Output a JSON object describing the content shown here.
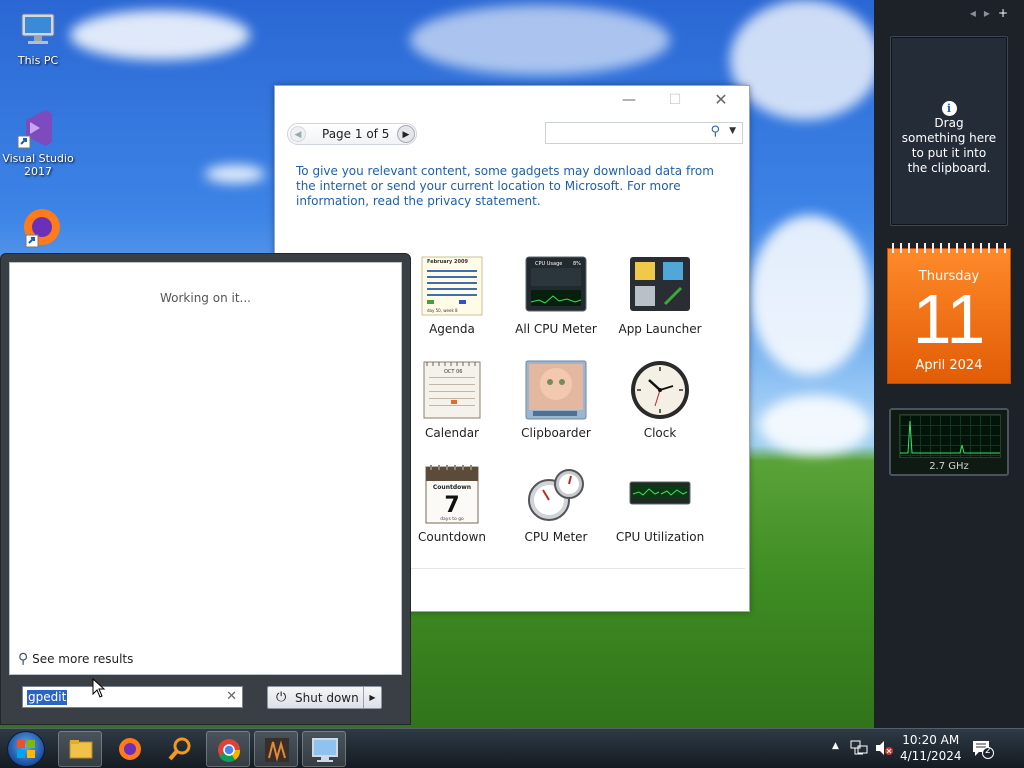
{
  "desktop": {
    "icons": [
      {
        "label": "This PC"
      },
      {
        "label": "Visual Studio 2017"
      },
      {
        "label": ""
      }
    ]
  },
  "gallery": {
    "page_label": "Page 1 of 5",
    "search_placeholder": "",
    "notice": "To give you relevant content, some gadgets may download data from the internet or send your current location to Microsoft. For more information, read the privacy statement.",
    "gadgets": [
      {
        "label": "Agenda",
        "icon": "agenda-icon"
      },
      {
        "label": "All CPU Meter",
        "icon": "cpu-meter-icon"
      },
      {
        "label": "App Launcher",
        "icon": "app-launcher-icon"
      },
      {
        "label": "Calendar",
        "icon": "calendar-icon"
      },
      {
        "label": "Clipboarder",
        "icon": "clipboarder-icon"
      },
      {
        "label": "Clock",
        "icon": "clock-icon"
      },
      {
        "label": "Countdown",
        "icon": "countdown-icon"
      },
      {
        "label": "CPU Meter",
        "icon": "cpu-gauge-icon"
      },
      {
        "label": "CPU Utilization",
        "icon": "cpu-utilization-icon"
      }
    ],
    "agenda_thumb": {
      "month": "February 2009",
      "week": "day 50, week 8"
    },
    "cpu_thumb": {
      "title": "CPU Usage",
      "pct": "8%"
    },
    "calendar_thumb": {
      "month": "OCT 06"
    },
    "countdown_thumb": {
      "title": "Countdown",
      "days": "7",
      "caption": "days to go"
    }
  },
  "start_menu": {
    "status": "Working on it...",
    "see_more": "See more results",
    "search_value": "gpedit",
    "shutdown_label": "Shut down"
  },
  "sidebar": {
    "clipboard_text": "Drag something here to put it into the clipboard.",
    "calendar": {
      "weekday": "Thursday",
      "day": "11",
      "month_year": "April 2024"
    },
    "cpu_freq": "2.7 GHz"
  },
  "taskbar": {
    "time": "10:20 AM",
    "date": "4/11/2024",
    "notifications": "2"
  }
}
